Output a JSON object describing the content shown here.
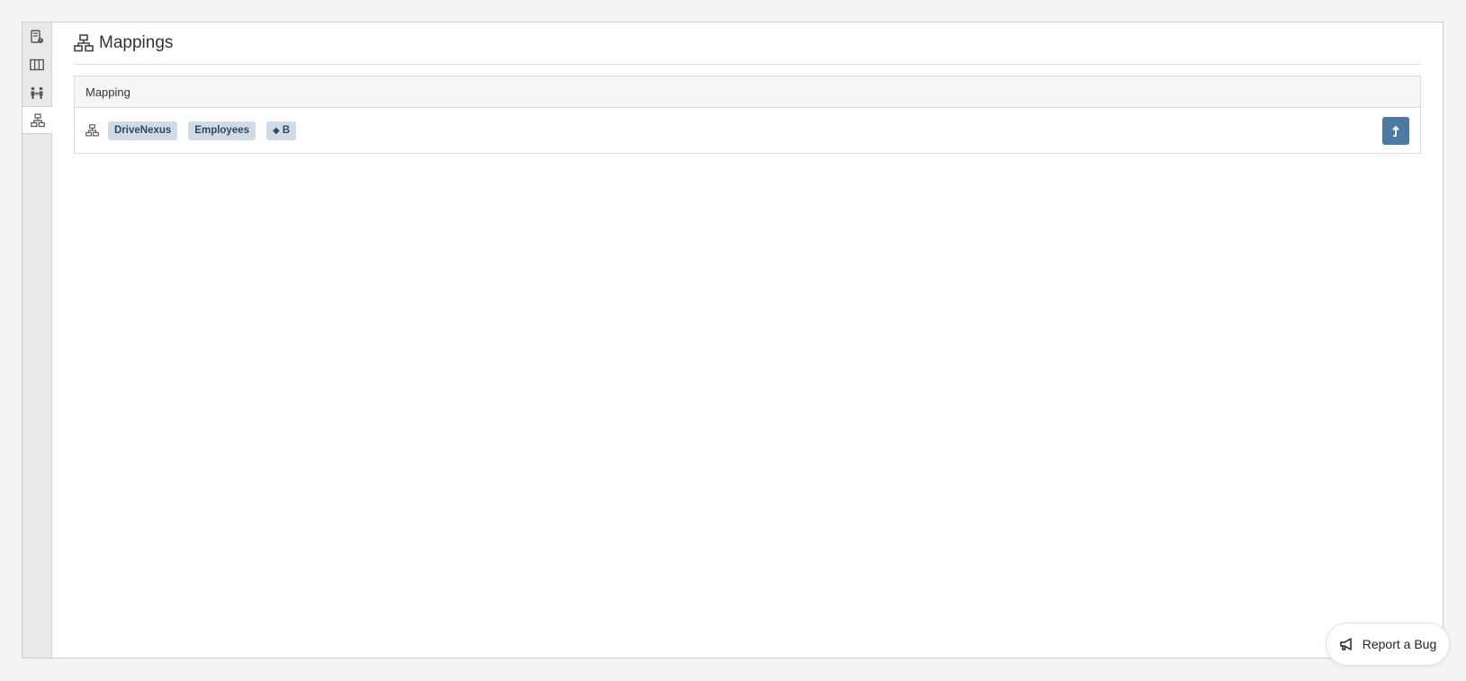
{
  "header": {
    "title": "Mappings",
    "icon": "sitemap-icon"
  },
  "rail": {
    "items": [
      {
        "name": "report-icon",
        "active": false
      },
      {
        "name": "columns-icon",
        "active": false
      },
      {
        "name": "people-arrows-icon",
        "active": false
      },
      {
        "name": "sitemap-icon",
        "active": true
      }
    ]
  },
  "table": {
    "column_header": "Mapping",
    "rows": [
      {
        "icon": "sitemap-icon",
        "tags": [
          "DriveNexus",
          "Employees"
        ],
        "label_tag": "B",
        "label_tag_icon": "tag-icon",
        "action_icon": "level-up-icon"
      }
    ]
  },
  "bug_button": {
    "label": "Report a Bug",
    "icon": "megaphone-icon"
  },
  "colors": {
    "accent": "#4d7aa3",
    "tag_bg": "#d0dbe5",
    "tag_text": "#2d4a63"
  }
}
